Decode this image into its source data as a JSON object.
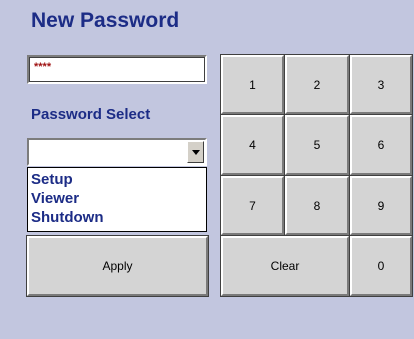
{
  "title": "New Password",
  "password_field": {
    "value": "****"
  },
  "password_select": {
    "label": "Password Select",
    "selected_value": "",
    "options": [
      "Setup",
      "Viewer",
      "Shutdown"
    ]
  },
  "keypad": {
    "keys": [
      "1",
      "2",
      "3",
      "4",
      "5",
      "6",
      "7",
      "8",
      "9"
    ],
    "clear_label": "Clear",
    "zero_label": "0"
  },
  "apply_label": "Apply"
}
